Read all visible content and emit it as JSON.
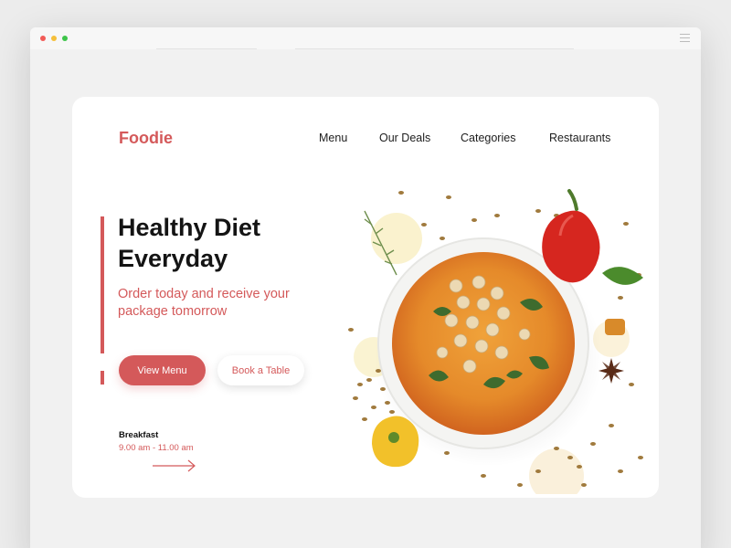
{
  "brand": {
    "name": "Foodie",
    "accent_color": "#d4595a"
  },
  "nav": {
    "items": [
      {
        "label": "Menu"
      },
      {
        "label": "Our Deals"
      },
      {
        "label": "Categories"
      },
      {
        "label": "Restaurants"
      }
    ]
  },
  "hero": {
    "title_line1": "Healthy Diet",
    "title_line2": "Everyday",
    "subtitle_line1": "Order today and receive your",
    "subtitle_line2": "package tomorrow",
    "primary_button": "View Menu",
    "secondary_button": "Book a Table"
  },
  "hours": {
    "label": "Breakfast",
    "time": "9.00 am - 11.00 am"
  },
  "window": {
    "controls": [
      "close",
      "minimize",
      "maximize"
    ],
    "menu_icon": "hamburger-icon"
  },
  "image": {
    "subject": "soup-bowl-with-peppers-and-spices"
  }
}
